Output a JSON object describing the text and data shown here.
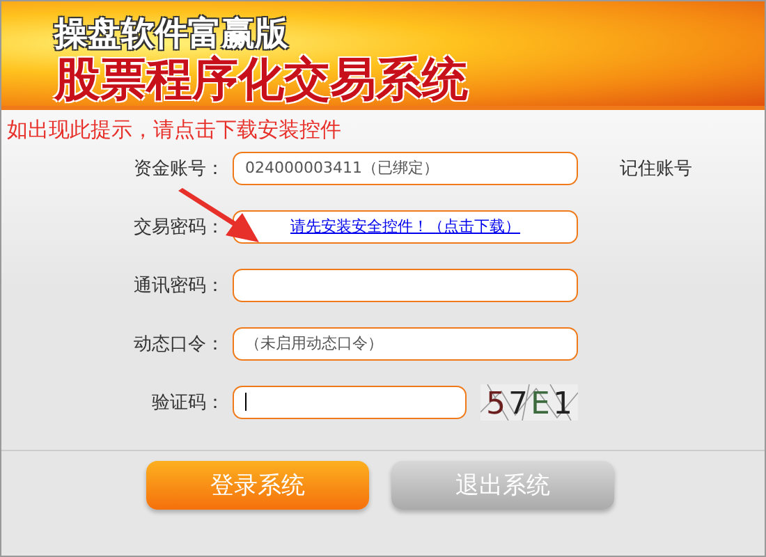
{
  "banner": {
    "subtitle": "操盘软件富赢版",
    "title": "股票程序化交易系统"
  },
  "notice": "如出现此提示，请点击下载安装控件",
  "fields": [
    {
      "label": "资金账号：",
      "kind": "text",
      "value": "024000003411（已绑定）"
    },
    {
      "label": "交易密码：",
      "kind": "link",
      "link": "请先安装安全控件！（点击下载）"
    },
    {
      "label": "通讯密码：",
      "kind": "text"
    },
    {
      "label": "动态口令：",
      "kind": "text",
      "value": "（未启用动态口令）"
    },
    {
      "label": "验证码：",
      "kind": "captcha",
      "captcha": "57E1"
    }
  ],
  "remember": "记住账号",
  "buttons": [
    {
      "label": "登录系统",
      "kind": "primary"
    },
    {
      "label": "退出系统",
      "kind": "secondary"
    }
  ]
}
